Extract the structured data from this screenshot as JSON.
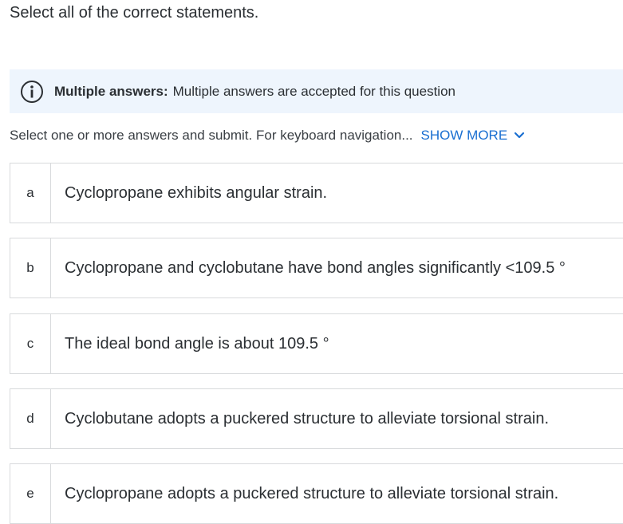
{
  "question": {
    "prompt": "Select all of the correct statements."
  },
  "banner": {
    "icon": "info-icon",
    "bold": "Multiple answers:",
    "text": "Multiple answers are accepted for this question"
  },
  "instructions": {
    "text": "Select one or more answers and submit. For keyboard navigation...",
    "show_more": "SHOW MORE",
    "show_more_icon": "chevron-down-icon"
  },
  "options": [
    {
      "letter": "a",
      "text": "Cyclopropane exhibits angular strain."
    },
    {
      "letter": "b",
      "text": "Cyclopropane and cyclobutane have bond angles significantly <109.5 °"
    },
    {
      "letter": "c",
      "text": "The ideal bond angle is about 109.5 °"
    },
    {
      "letter": "d",
      "text": "Cyclobutane adopts a puckered structure to alleviate torsional strain."
    },
    {
      "letter": "e",
      "text": "Cyclopropane adopts a puckered structure to alleviate torsional strain."
    }
  ],
  "colors": {
    "accent": "#1a6fd1",
    "banner_bg": "#eef5fd",
    "border": "#d8dadc"
  }
}
